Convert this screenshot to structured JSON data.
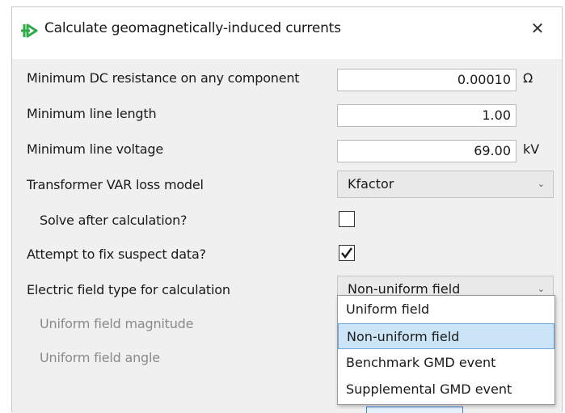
{
  "window": {
    "title": "Calculate geomagnetically-induced currents",
    "close_glyph": "✕",
    "icon": "green-arrow-icon",
    "icon_color": "#2eab4a"
  },
  "fields": {
    "min_dc_resistance": {
      "label": "Minimum DC resistance on any component",
      "value": "0.00010",
      "unit": "Ω"
    },
    "min_line_length": {
      "label": "Minimum line length",
      "value": "1.00"
    },
    "min_line_voltage": {
      "label": "Minimum line voltage",
      "value": "69.00",
      "unit": "kV"
    },
    "transformer_var_loss_model": {
      "label": "Transformer VAR loss model",
      "value": "Kfactor"
    },
    "solve_after_calculation": {
      "label": "Solve after calculation?",
      "checked": false
    },
    "attempt_fix_suspect_data": {
      "label": "Attempt to fix suspect data?",
      "checked": true
    },
    "electric_field_type": {
      "label": "Electric field type for calculation",
      "value": "Non-uniform field"
    },
    "uniform_field_magnitude": {
      "label": "Uniform field magnitude"
    },
    "uniform_field_angle": {
      "label": "Uniform field angle"
    }
  },
  "dropdown": {
    "options": [
      {
        "label": "Uniform field",
        "selected": false
      },
      {
        "label": "Non-uniform field",
        "selected": true
      },
      {
        "label": "Benchmark GMD event",
        "selected": false
      },
      {
        "label": "Supplemental GMD event",
        "selected": false
      }
    ]
  },
  "colors": {
    "accent": "#2eab4a",
    "selection_bg": "#cce4f7",
    "selection_border": "#6fa8dc"
  }
}
